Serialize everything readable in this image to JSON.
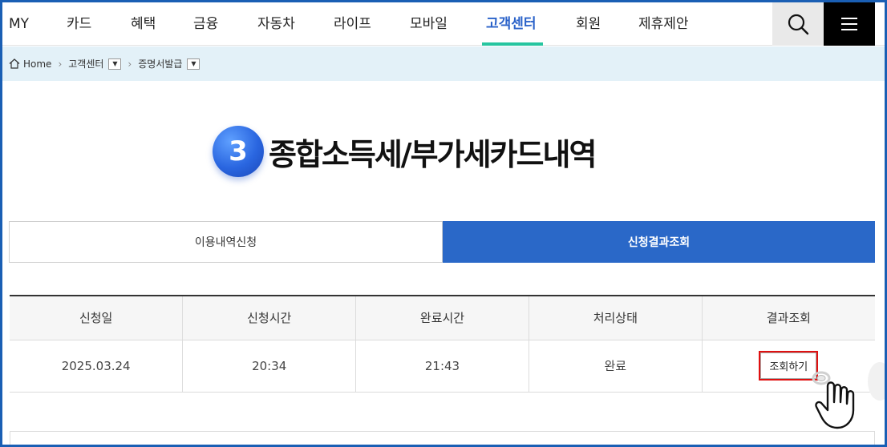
{
  "nav": {
    "items": [
      {
        "label": "MY"
      },
      {
        "label": "카드"
      },
      {
        "label": "혜택"
      },
      {
        "label": "금융"
      },
      {
        "label": "자동차"
      },
      {
        "label": "라이프"
      },
      {
        "label": "모바일"
      },
      {
        "label": "고객센터",
        "active": true
      },
      {
        "label": "회원"
      },
      {
        "label": "제휴제안"
      }
    ],
    "search_icon": "search-icon",
    "menu_icon": "hamburger-menu-icon"
  },
  "breadcrumb": {
    "home": "Home",
    "level1": "고객센터",
    "level2": "증명서발급"
  },
  "title": {
    "step": "3",
    "text": "종합소득세/부가세카드내역"
  },
  "tabs": [
    {
      "label": "이용내역신청",
      "active": false
    },
    {
      "label": "신청결과조회",
      "active": true
    }
  ],
  "table": {
    "headers": [
      "신청일",
      "신청시간",
      "완료시간",
      "처리상태",
      "결과조회"
    ],
    "rows": [
      {
        "date": "2025.03.24",
        "request_time": "20:34",
        "complete_time": "21:43",
        "status": "완료",
        "action": "조회하기"
      }
    ]
  },
  "colors": {
    "accent": "#2a68c8",
    "active_nav": "#2a62c9",
    "nav_underline": "#26c5a0",
    "highlight": "#e01010",
    "breadcrumb_bg": "#e3f1f8"
  }
}
